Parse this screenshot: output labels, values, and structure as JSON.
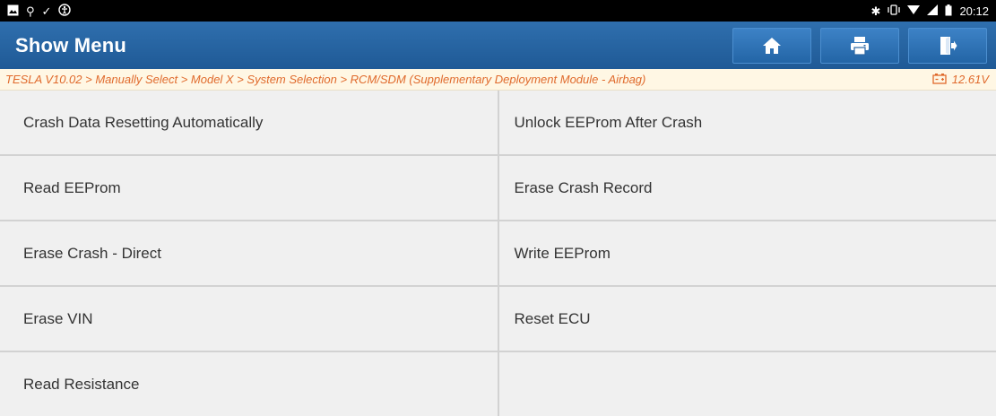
{
  "status_bar": {
    "time": "20:12",
    "left_icons": [
      "image-icon",
      "usb-icon",
      "check-icon",
      "accessibility-icon"
    ],
    "right_icons": [
      "bluetooth-icon",
      "vibrate-icon",
      "wifi-icon",
      "signal-icon",
      "battery-icon"
    ]
  },
  "header": {
    "title": "Show Menu",
    "buttons": [
      "home-icon",
      "print-icon",
      "exit-icon"
    ]
  },
  "breadcrumb": {
    "path": "TESLA V10.02 > Manually Select > Model X > System Selection > RCM/SDM (Supplementary Deployment Module - Airbag)",
    "voltage": "12.61V"
  },
  "menu": {
    "items": [
      "Crash Data Resetting Automatically",
      "Unlock EEProm After Crash",
      "Read EEProm",
      "Erase Crash Record",
      "Erase Crash - Direct",
      "Write EEProm",
      "Erase VIN",
      "Reset ECU",
      "Read Resistance"
    ]
  },
  "colors": {
    "header_blue": "#2a66a3",
    "breadcrumb_text": "#e06a2c",
    "breadcrumb_bg": "#fff7e4"
  }
}
